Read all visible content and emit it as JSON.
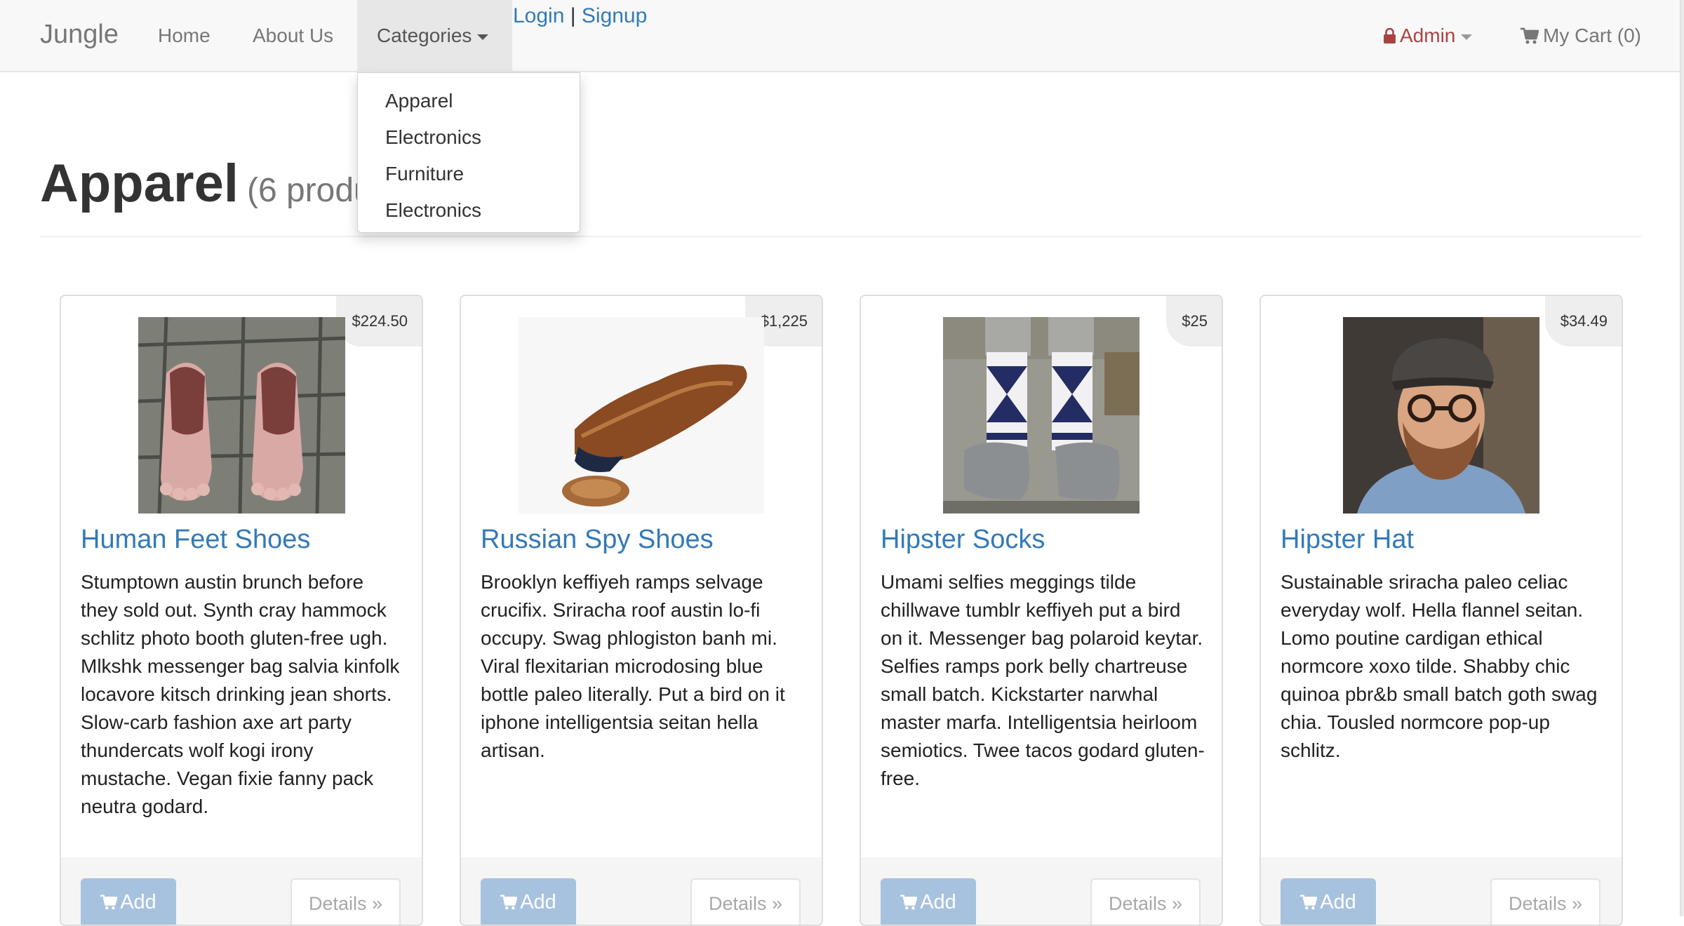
{
  "navbar": {
    "brand": "Jungle",
    "home": "Home",
    "about": "About Us",
    "categories": "Categories",
    "login": "Login",
    "separator": "|",
    "signup": "Signup",
    "admin": "Admin",
    "cart": "My Cart (0)"
  },
  "dropdown": {
    "items": [
      {
        "label": "Apparel"
      },
      {
        "label": "Electronics"
      },
      {
        "label": "Furniture"
      },
      {
        "label": "Electronics"
      }
    ]
  },
  "page": {
    "title": "Apparel",
    "count": "(6 produ"
  },
  "products": [
    {
      "price": "$224.50",
      "name": "Human Feet Shoes",
      "description": "Stumptown austin brunch before they sold out. Synth cray hammock schlitz photo booth gluten-free ugh. Mlkshk messenger bag salvia kinfolk locavore kitsch drinking jean shorts. Slow-carb fashion axe art party thundercats wolf kogi irony mustache. Vegan fixie fanny pack neutra godard.",
      "add": "Add",
      "details": "Details »"
    },
    {
      "price": "$1,225",
      "name": "Russian Spy Shoes",
      "description": "Brooklyn keffiyeh ramps selvage crucifix. Sriracha roof austin lo-fi occupy. Swag phlogiston banh mi. Viral flexitarian microdosing blue bottle paleo literally. Put a bird on it iphone intelligentsia seitan hella artisan.",
      "add": "Add",
      "details": "Details »"
    },
    {
      "price": "$25",
      "name": "Hipster Socks",
      "description": "Umami selfies meggings tilde chillwave tumblr keffiyeh put a bird on it. Messenger bag polaroid keytar. Selfies ramps pork belly chartreuse small batch. Kickstarter narwhal master marfa. Intelligentsia heirloom semiotics. Twee tacos godard gluten-free.",
      "add": "Add",
      "details": "Details »"
    },
    {
      "price": "$34.49",
      "name": "Hipster Hat",
      "description": "Sustainable sriracha paleo celiac everyday wolf. Hella flannel seitan. Lomo poutine cardigan ethical normcore xoxo tilde. Shabby chic quinoa pbr&b small batch goth swag chia. Tousled normcore pop-up schlitz.",
      "add": "Add",
      "details": "Details »"
    }
  ],
  "colors": {
    "link": "#337ab7",
    "admin": "#a94442",
    "add_button": "#a7c2de",
    "navbar_bg": "#f8f8f8"
  },
  "icons": [
    "lock-icon",
    "cart-icon",
    "caret-down-icon"
  ]
}
